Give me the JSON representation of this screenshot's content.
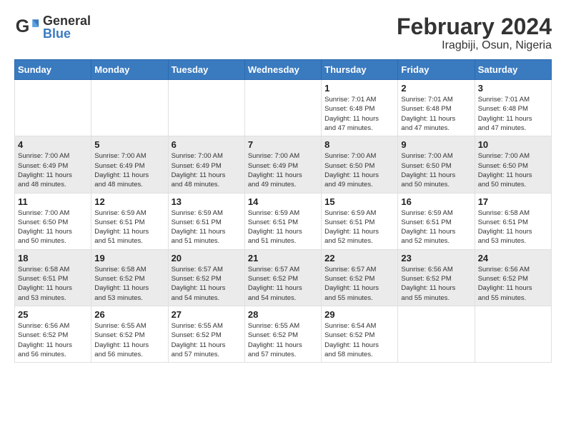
{
  "header": {
    "logo_general": "General",
    "logo_blue": "Blue",
    "title": "February 2024",
    "subtitle": "Iragbiji, Osun, Nigeria"
  },
  "weekdays": [
    "Sunday",
    "Monday",
    "Tuesday",
    "Wednesday",
    "Thursday",
    "Friday",
    "Saturday"
  ],
  "weeks": [
    [
      {
        "day": "",
        "info": ""
      },
      {
        "day": "",
        "info": ""
      },
      {
        "day": "",
        "info": ""
      },
      {
        "day": "",
        "info": ""
      },
      {
        "day": "1",
        "info": "Sunrise: 7:01 AM\nSunset: 6:48 PM\nDaylight: 11 hours\nand 47 minutes."
      },
      {
        "day": "2",
        "info": "Sunrise: 7:01 AM\nSunset: 6:48 PM\nDaylight: 11 hours\nand 47 minutes."
      },
      {
        "day": "3",
        "info": "Sunrise: 7:01 AM\nSunset: 6:48 PM\nDaylight: 11 hours\nand 47 minutes."
      }
    ],
    [
      {
        "day": "4",
        "info": "Sunrise: 7:00 AM\nSunset: 6:49 PM\nDaylight: 11 hours\nand 48 minutes."
      },
      {
        "day": "5",
        "info": "Sunrise: 7:00 AM\nSunset: 6:49 PM\nDaylight: 11 hours\nand 48 minutes."
      },
      {
        "day": "6",
        "info": "Sunrise: 7:00 AM\nSunset: 6:49 PM\nDaylight: 11 hours\nand 48 minutes."
      },
      {
        "day": "7",
        "info": "Sunrise: 7:00 AM\nSunset: 6:49 PM\nDaylight: 11 hours\nand 49 minutes."
      },
      {
        "day": "8",
        "info": "Sunrise: 7:00 AM\nSunset: 6:50 PM\nDaylight: 11 hours\nand 49 minutes."
      },
      {
        "day": "9",
        "info": "Sunrise: 7:00 AM\nSunset: 6:50 PM\nDaylight: 11 hours\nand 50 minutes."
      },
      {
        "day": "10",
        "info": "Sunrise: 7:00 AM\nSunset: 6:50 PM\nDaylight: 11 hours\nand 50 minutes."
      }
    ],
    [
      {
        "day": "11",
        "info": "Sunrise: 7:00 AM\nSunset: 6:50 PM\nDaylight: 11 hours\nand 50 minutes."
      },
      {
        "day": "12",
        "info": "Sunrise: 6:59 AM\nSunset: 6:51 PM\nDaylight: 11 hours\nand 51 minutes."
      },
      {
        "day": "13",
        "info": "Sunrise: 6:59 AM\nSunset: 6:51 PM\nDaylight: 11 hours\nand 51 minutes."
      },
      {
        "day": "14",
        "info": "Sunrise: 6:59 AM\nSunset: 6:51 PM\nDaylight: 11 hours\nand 51 minutes."
      },
      {
        "day": "15",
        "info": "Sunrise: 6:59 AM\nSunset: 6:51 PM\nDaylight: 11 hours\nand 52 minutes."
      },
      {
        "day": "16",
        "info": "Sunrise: 6:59 AM\nSunset: 6:51 PM\nDaylight: 11 hours\nand 52 minutes."
      },
      {
        "day": "17",
        "info": "Sunrise: 6:58 AM\nSunset: 6:51 PM\nDaylight: 11 hours\nand 53 minutes."
      }
    ],
    [
      {
        "day": "18",
        "info": "Sunrise: 6:58 AM\nSunset: 6:51 PM\nDaylight: 11 hours\nand 53 minutes."
      },
      {
        "day": "19",
        "info": "Sunrise: 6:58 AM\nSunset: 6:52 PM\nDaylight: 11 hours\nand 53 minutes."
      },
      {
        "day": "20",
        "info": "Sunrise: 6:57 AM\nSunset: 6:52 PM\nDaylight: 11 hours\nand 54 minutes."
      },
      {
        "day": "21",
        "info": "Sunrise: 6:57 AM\nSunset: 6:52 PM\nDaylight: 11 hours\nand 54 minutes."
      },
      {
        "day": "22",
        "info": "Sunrise: 6:57 AM\nSunset: 6:52 PM\nDaylight: 11 hours\nand 55 minutes."
      },
      {
        "day": "23",
        "info": "Sunrise: 6:56 AM\nSunset: 6:52 PM\nDaylight: 11 hours\nand 55 minutes."
      },
      {
        "day": "24",
        "info": "Sunrise: 6:56 AM\nSunset: 6:52 PM\nDaylight: 11 hours\nand 55 minutes."
      }
    ],
    [
      {
        "day": "25",
        "info": "Sunrise: 6:56 AM\nSunset: 6:52 PM\nDaylight: 11 hours\nand 56 minutes."
      },
      {
        "day": "26",
        "info": "Sunrise: 6:55 AM\nSunset: 6:52 PM\nDaylight: 11 hours\nand 56 minutes."
      },
      {
        "day": "27",
        "info": "Sunrise: 6:55 AM\nSunset: 6:52 PM\nDaylight: 11 hours\nand 57 minutes."
      },
      {
        "day": "28",
        "info": "Sunrise: 6:55 AM\nSunset: 6:52 PM\nDaylight: 11 hours\nand 57 minutes."
      },
      {
        "day": "29",
        "info": "Sunrise: 6:54 AM\nSunset: 6:52 PM\nDaylight: 11 hours\nand 58 minutes."
      },
      {
        "day": "",
        "info": ""
      },
      {
        "day": "",
        "info": ""
      }
    ]
  ],
  "row_bg": [
    "#ffffff",
    "#ebebeb",
    "#ffffff",
    "#ebebeb",
    "#ffffff"
  ]
}
